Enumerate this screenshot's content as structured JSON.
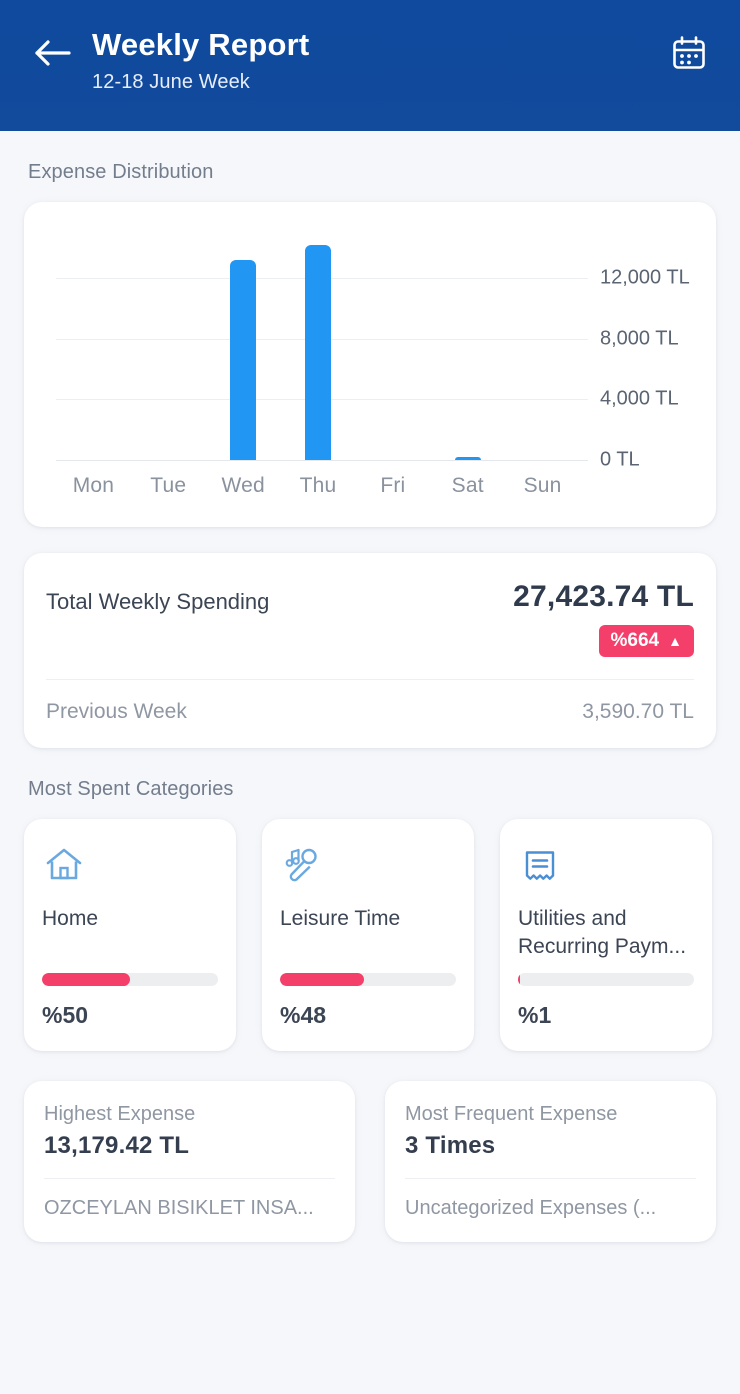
{
  "header": {
    "back_icon": "arrow-left-icon",
    "title": "Weekly Report",
    "subtitle": "12-18 June Week",
    "calendar_icon": "calendar-icon",
    "bg_color": "#124a9c"
  },
  "sections": {
    "expense_distribution": "Expense Distribution",
    "most_spent_categories": "Most Spent Categories"
  },
  "chart_data": {
    "type": "bar",
    "title": "Expense Distribution",
    "xlabel": "",
    "ylabel": "",
    "categories": [
      "Mon",
      "Tue",
      "Wed",
      "Thu",
      "Fri",
      "Sat",
      "Sun"
    ],
    "values": [
      0,
      0,
      13250,
      14180,
      0,
      200,
      0
    ],
    "ytick_labels": [
      "12,000 TL",
      "8,000 TL",
      "4,000 TL",
      "0 TL"
    ],
    "ytick_values": [
      12000,
      8000,
      4000,
      0
    ],
    "ylim": [
      0,
      15200
    ],
    "grid": true,
    "legend": false,
    "bar_color": "#2196f3",
    "currency_suffix": "TL"
  },
  "total": {
    "label": "Total Weekly Spending",
    "amount": "27,423.74 TL",
    "delta": "%664",
    "delta_direction": "▲",
    "delta_color": "#f43f6a",
    "previous_label": "Previous Week",
    "previous_amount": "3,590.70 TL"
  },
  "categories": [
    {
      "icon": "home-icon",
      "name": "Home",
      "percent_label": "%50",
      "percent": 50
    },
    {
      "icon": "music-microphone-icon",
      "name": "Leisure Time",
      "percent_label": "%48",
      "percent": 48
    },
    {
      "icon": "receipt-icon",
      "name": "Utilities and Recurring Paym...",
      "percent_label": "%1",
      "percent": 1
    }
  ],
  "stats": [
    {
      "label": "Highest Expense",
      "value": "13,179.42 TL",
      "desc": "OZCEYLAN BISIKLET INSA..."
    },
    {
      "label": "Most Frequent Expense",
      "value": "3 Times",
      "desc": "Uncategorized Expenses (..."
    }
  ]
}
